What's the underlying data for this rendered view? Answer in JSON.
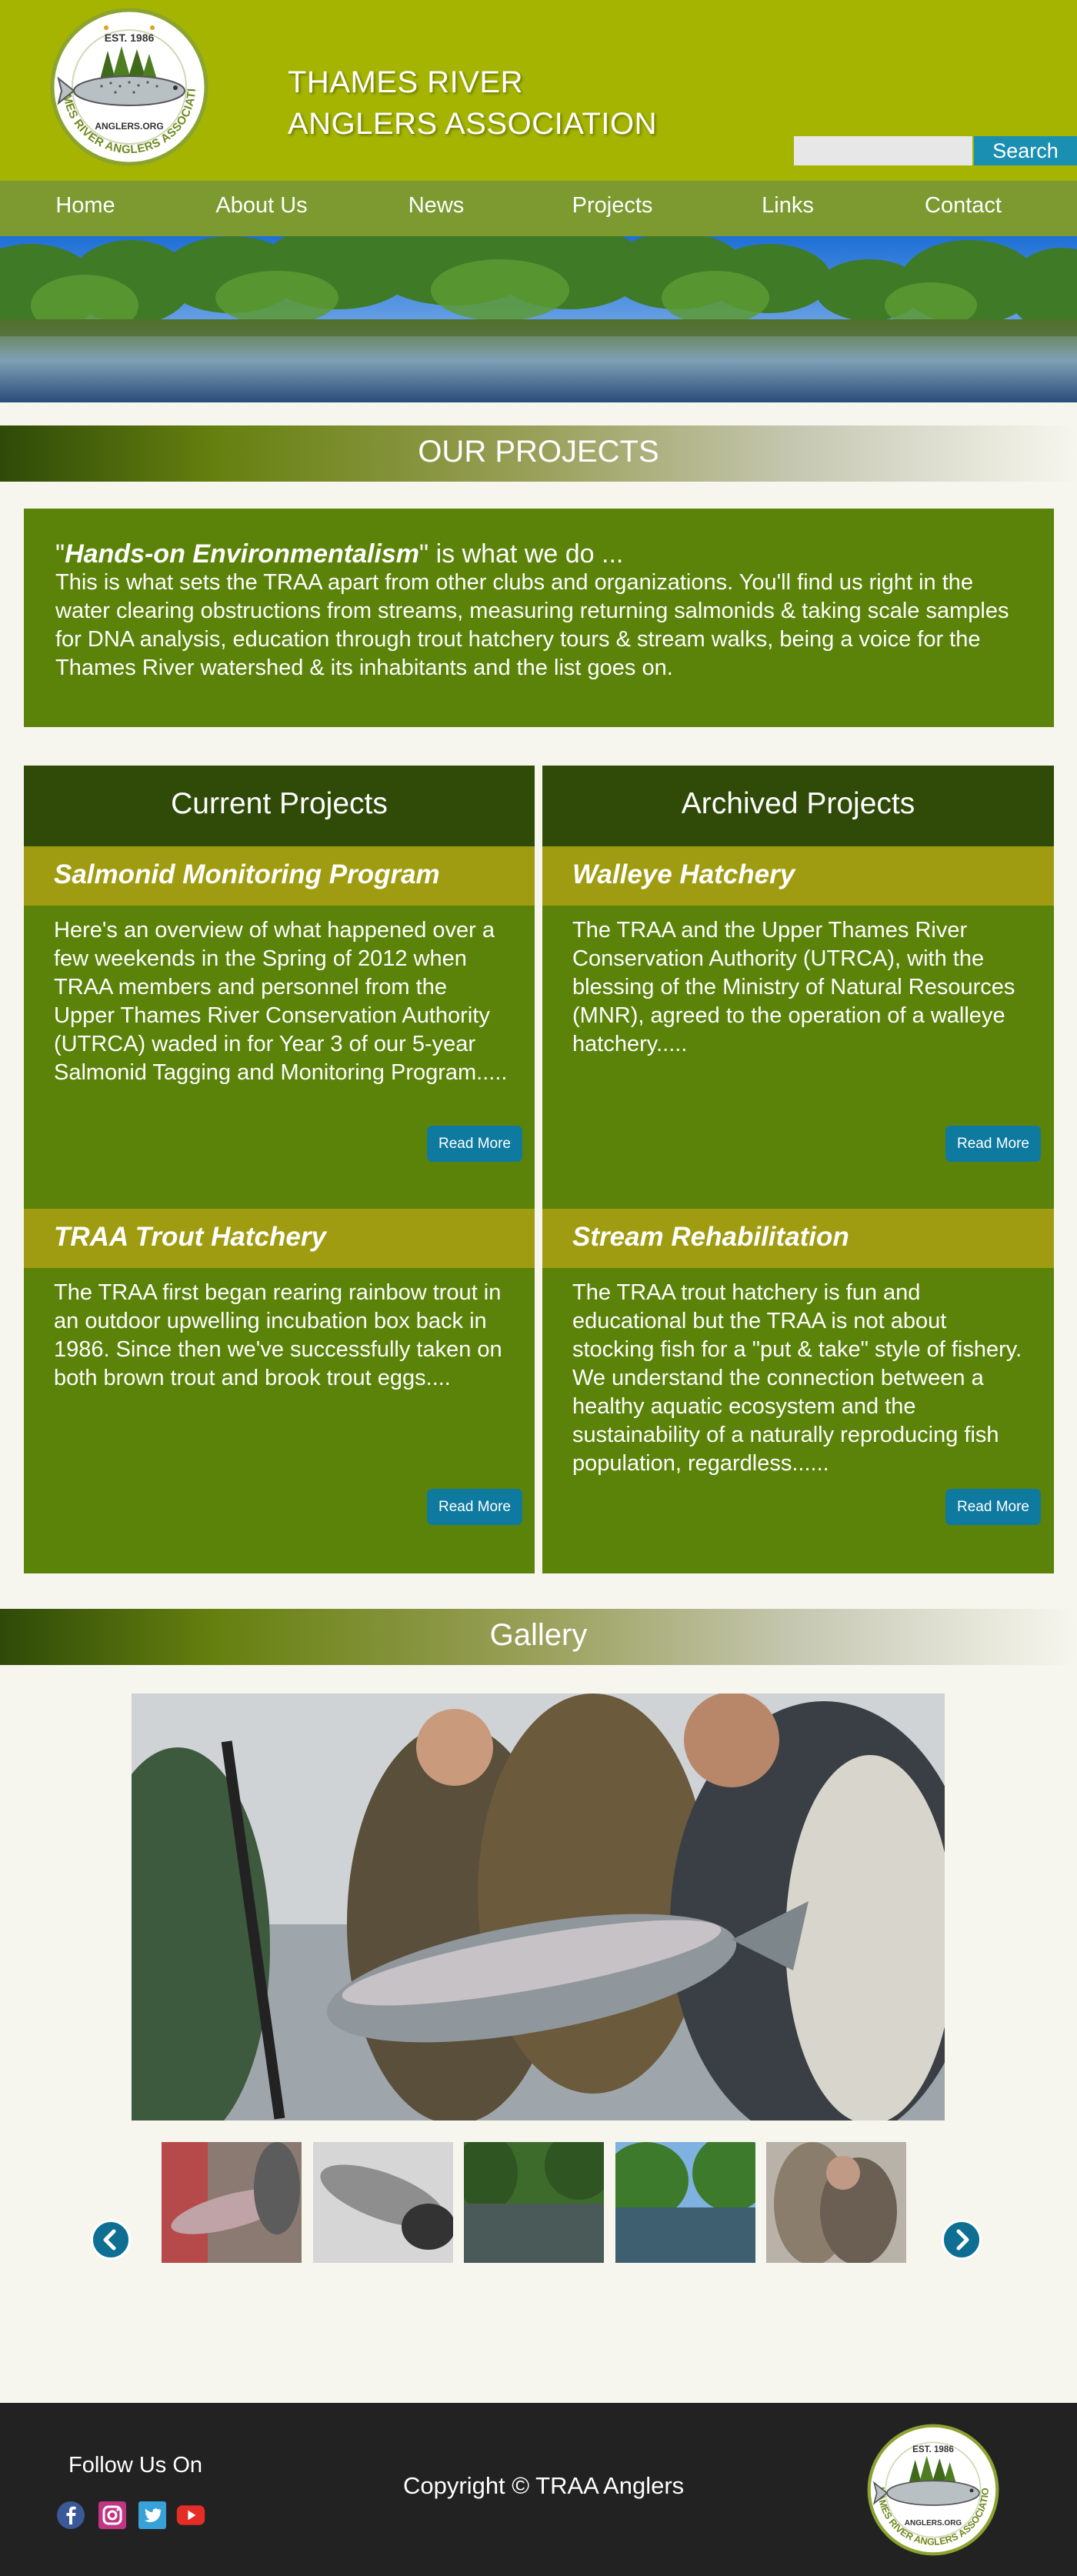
{
  "header": {
    "logo": {
      "est": "EST. 1986",
      "url_text": "ANGLERS.ORG",
      "ring_text": "THAMES RIVER ANGLERS ASSOCIATION"
    },
    "title_line1": "THAMES RIVER",
    "title_line2": "ANGLERS ASSOCIATION",
    "search": {
      "placeholder": "",
      "value": "",
      "button_label": "Search"
    }
  },
  "nav": {
    "items": [
      {
        "label": "Home"
      },
      {
        "label": "About Us"
      },
      {
        "label": "News"
      },
      {
        "label": "Projects"
      },
      {
        "label": "Links"
      },
      {
        "label": "Contact"
      }
    ]
  },
  "projects_section": {
    "title": "OUR PROJECTS"
  },
  "intro": {
    "quote_open": "\"",
    "quote_bold": "Hands-on Environmentalism",
    "quote_rest": "\" is what we do ...",
    "body": "This is what sets the TRAA apart from other clubs and organizations. You'll find us right in the water clearing obstructions from streams, measuring returning salmonids & taking scale samples for DNA analysis, education through trout hatchery tours & stream walks, being a voice for the Thames River watershed & its inhabitants and the list goes on."
  },
  "current_projects": {
    "heading": "Current Projects",
    "items": [
      {
        "title": "Salmonid Monitoring Program",
        "description": "Here's an overview of what happened over a few weekends in the Spring of 2012 when TRAA members and personnel from the Upper Thames River Conservation Authority (UTRCA) waded in for Year 3 of our 5-year Salmonid Tagging and Monitoring Program.....",
        "button": "Read More"
      },
      {
        "title": "TRAA Trout Hatchery",
        "description": "The TRAA first began rearing rainbow trout in an outdoor upwelling incubation box back in 1986. Since then we've successfully taken on both brown trout and brook trout eggs....",
        "button": "Read More"
      }
    ]
  },
  "archived_projects": {
    "heading": "Archived Projects",
    "items": [
      {
        "title": "Walleye Hatchery",
        "description": "The TRAA and the Upper Thames River Conservation Authority (UTRCA), with the blessing of the Ministry of Natural Resources (MNR), agreed to the operation of a walleye hatchery.....",
        "button": "Read More"
      },
      {
        "title": "Stream Rehabilitation",
        "description": "The TRAA trout hatchery is fun and educational but the TRAA is not about stocking fish for a \"put & take\" style of fishery. We understand the connection between a healthy aquatic ecosystem and the sustainability of a naturally reproducing fish population, regardless......",
        "button": "Read More"
      }
    ]
  },
  "gallery": {
    "title": "Gallery"
  },
  "footer": {
    "follow_label": "Follow Us On",
    "social": [
      "facebook-icon",
      "instagram-icon",
      "twitter-icon",
      "youtube-icon"
    ],
    "copyright": "Copyright © TRAA Anglers"
  },
  "colors": {
    "header_bg": "#a4b400",
    "nav_bg": "#7c9a30",
    "panel_green": "#5b8309",
    "panel_dark": "#304a08",
    "project_title_bar": "#a09c12",
    "button_blue": "#0e7aa0",
    "footer_bg": "#222222",
    "page_bg": "#f7f6ee"
  }
}
